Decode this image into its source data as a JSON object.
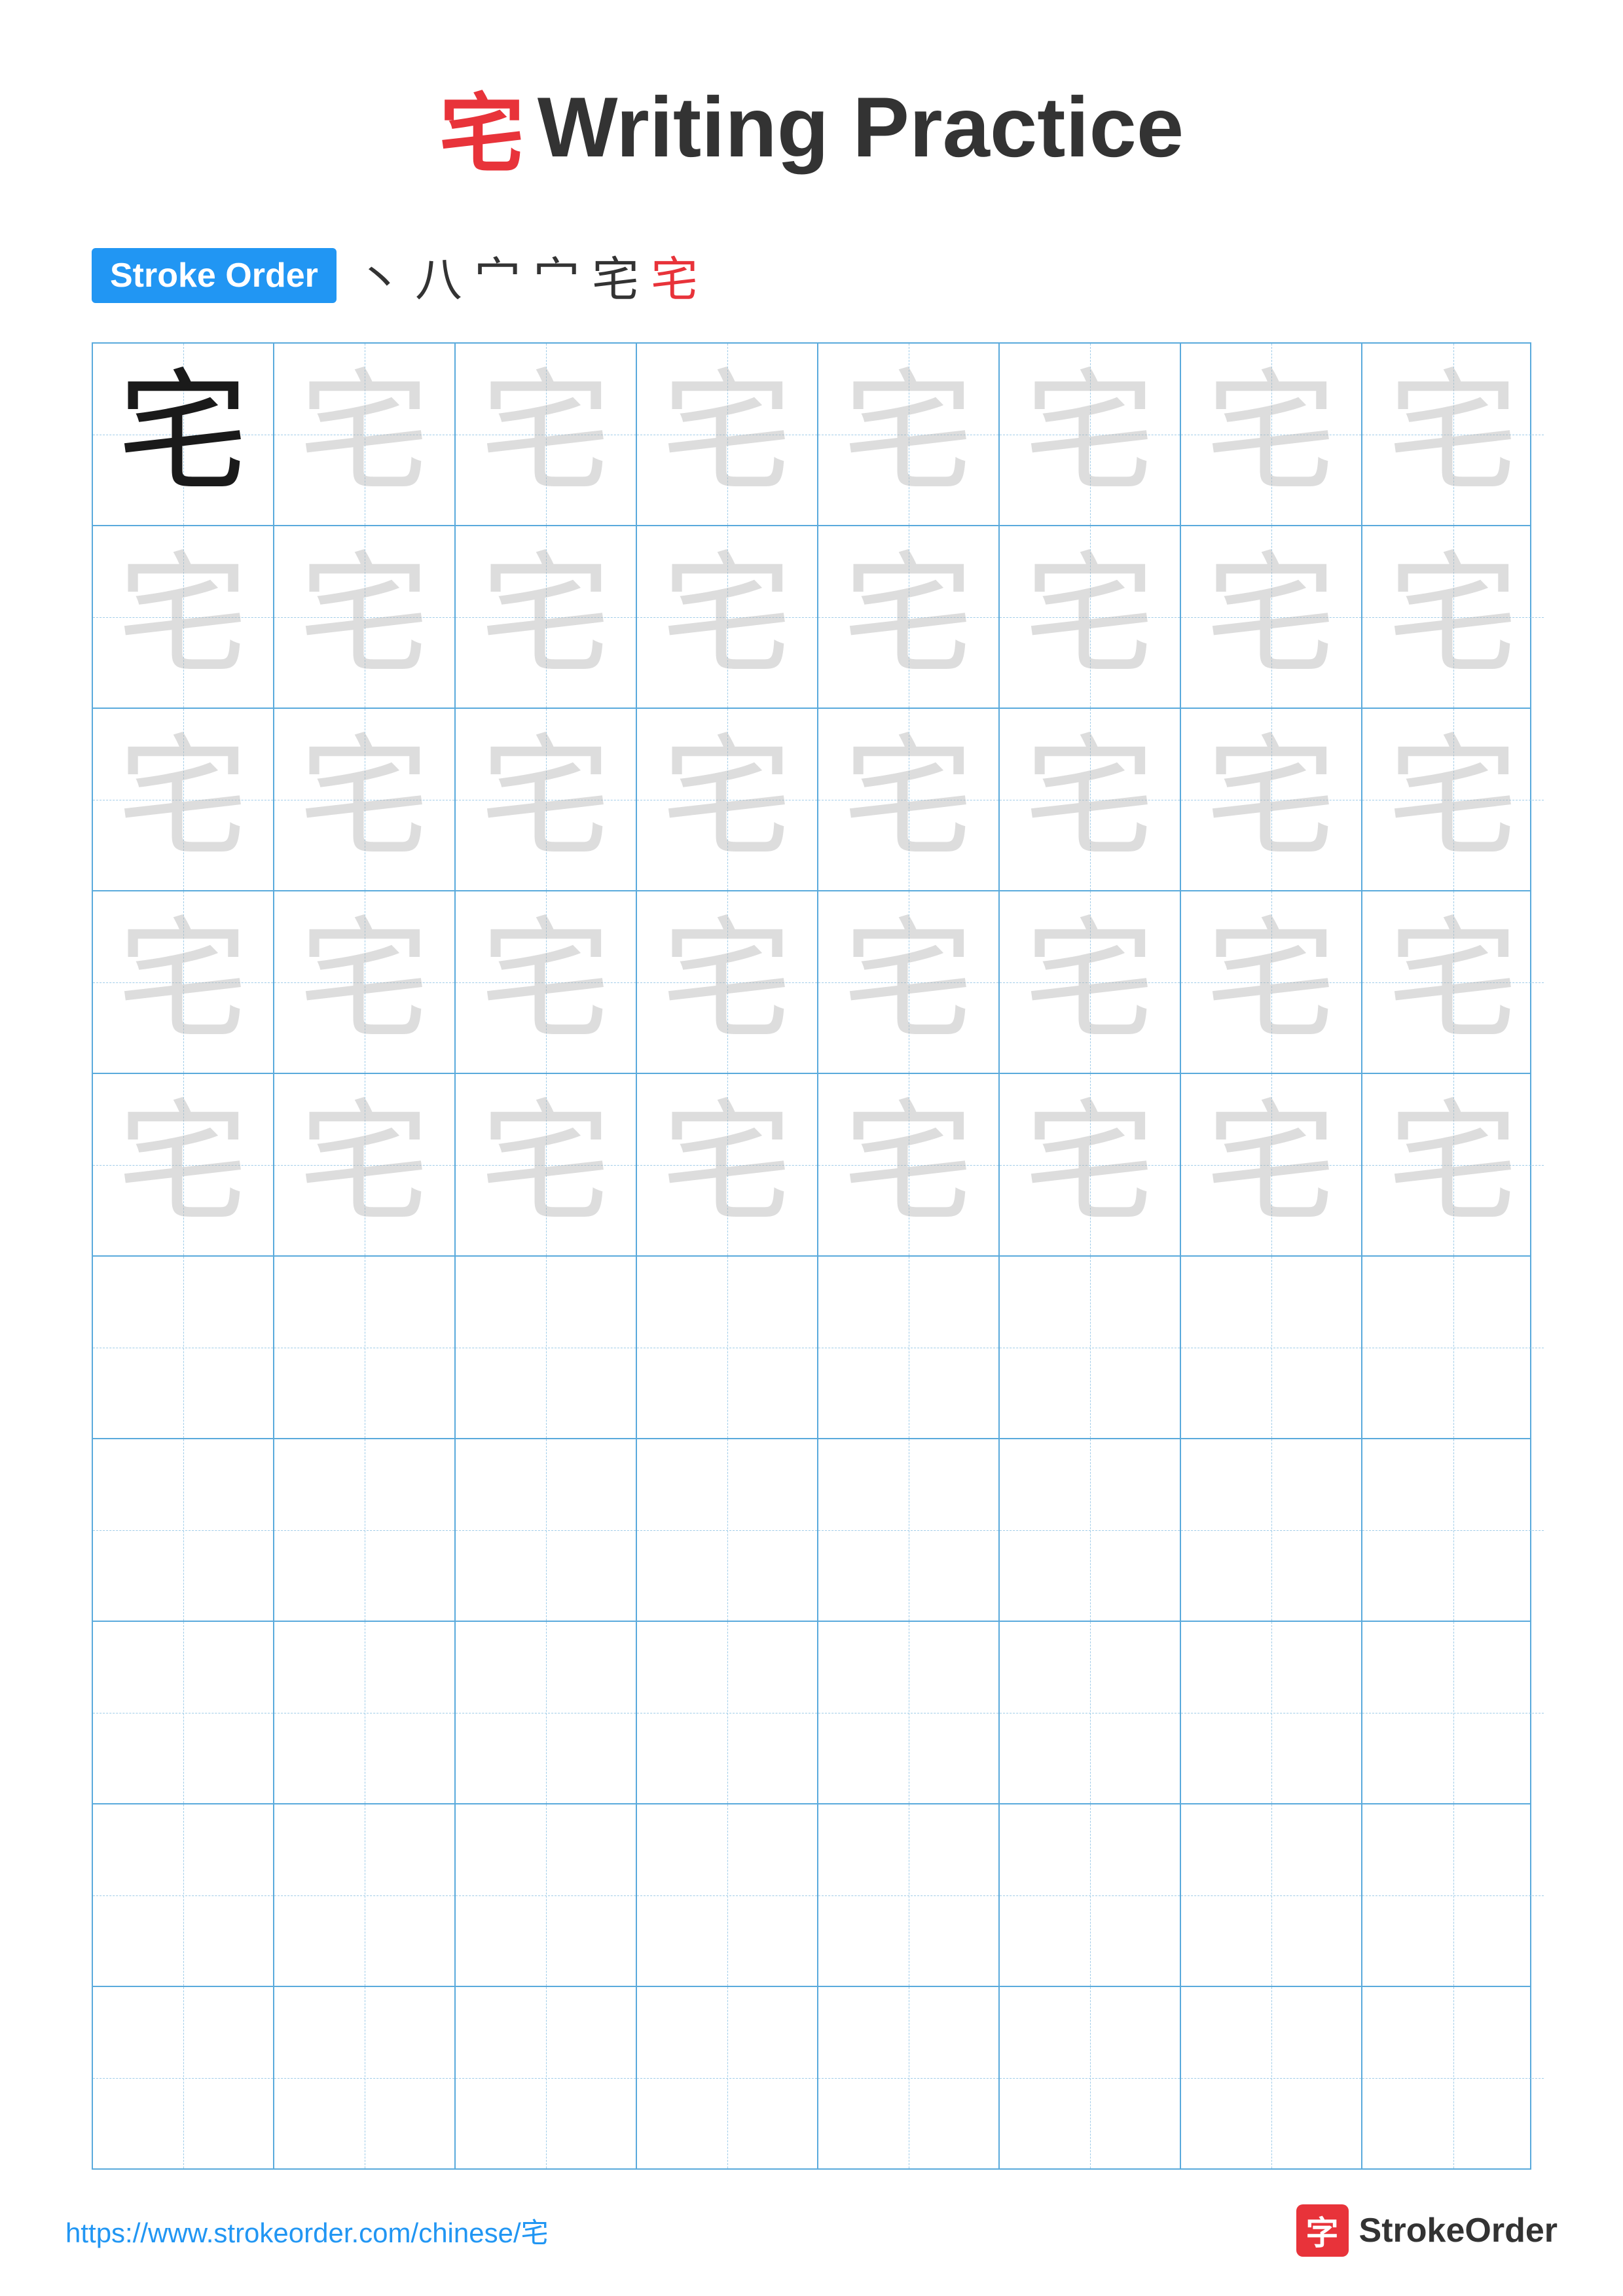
{
  "title": {
    "char": "宅",
    "text": "Writing Practice"
  },
  "stroke_order": {
    "badge_label": "Stroke Order",
    "sequence": [
      "丶",
      "八",
      "宀",
      "宀",
      "宅",
      "宅"
    ]
  },
  "grid": {
    "cols": 8,
    "practice_rows_with_chars": 5,
    "practice_rows_empty": 5,
    "character": "宅"
  },
  "footer": {
    "url": "https://www.strokeorder.com/chinese/宅",
    "logo_char": "字",
    "logo_text": "StrokeOrder"
  }
}
